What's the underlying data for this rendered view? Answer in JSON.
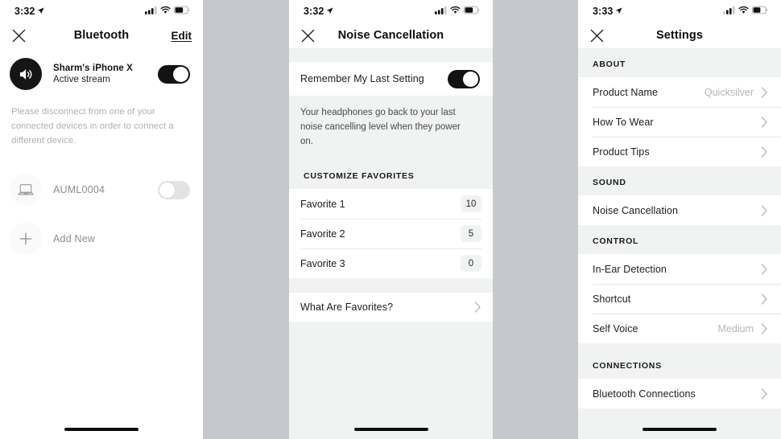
{
  "panels": {
    "bluetooth": {
      "status": {
        "time": "3:32",
        "location_icon": "location-arrow-icon",
        "cellular_icon": "cellular-bars-icon",
        "wifi_icon": "wifi-icon",
        "battery_icon": "battery-icon"
      },
      "nav": {
        "close_label": "✕",
        "title": "Bluetooth",
        "edit_label": "Edit"
      },
      "connected_device": {
        "icon": "speaker-icon",
        "name": "Sharm's iPhone X",
        "status": "Active stream",
        "toggle_state": "on"
      },
      "helper_text": "Please disconnect from one of your connected devices in order to connect a different device.",
      "other_device": {
        "icon": "laptop-icon",
        "name": "AUML0004",
        "toggle_state": "off"
      },
      "add_new": {
        "icon": "plus-icon",
        "label": "Add New"
      }
    },
    "noise_cancellation": {
      "status": {
        "time": "3:32",
        "location_icon": "location-arrow-icon",
        "cellular_icon": "cellular-bars-icon",
        "wifi_icon": "wifi-icon",
        "battery_icon": "battery-icon"
      },
      "nav": {
        "close_label": "✕",
        "title": "Noise Cancellation"
      },
      "remember": {
        "label": "Remember My Last Setting",
        "toggle_state": "on"
      },
      "description": "Your headphones go back to your last noise cancelling level when they power on.",
      "favorites_header": "CUSTOMIZE FAVORITES",
      "favorites": [
        {
          "label": "Favorite 1",
          "value": "10"
        },
        {
          "label": "Favorite 2",
          "value": "5"
        },
        {
          "label": "Favorite 3",
          "value": "0"
        }
      ],
      "what_are_favorites": {
        "label": "What Are Favorites?",
        "chevron": "chevron-right-icon"
      }
    },
    "settings": {
      "status": {
        "time": "3:33",
        "location_icon": "location-arrow-icon",
        "cellular_icon": "cellular-bars-icon",
        "wifi_icon": "wifi-icon",
        "battery_icon": "battery-icon"
      },
      "nav": {
        "close_label": "✕",
        "title": "Settings"
      },
      "sections": [
        {
          "header": "ABOUT",
          "rows": [
            {
              "label": "Product Name",
              "value": "Quicksilver",
              "chevron": "chevron-right-icon"
            },
            {
              "label": "How To Wear",
              "value": "",
              "chevron": "chevron-right-icon"
            },
            {
              "label": "Product Tips",
              "value": "",
              "chevron": "chevron-right-icon"
            }
          ]
        },
        {
          "header": "SOUND",
          "rows": [
            {
              "label": "Noise Cancellation",
              "value": "",
              "chevron": "chevron-right-icon"
            }
          ]
        },
        {
          "header": "CONTROL",
          "rows": [
            {
              "label": "In-Ear Detection",
              "value": "",
              "chevron": "chevron-right-icon"
            },
            {
              "label": "Shortcut",
              "value": "",
              "chevron": "chevron-right-icon"
            },
            {
              "label": "Self Voice",
              "value": "Medium",
              "chevron": "chevron-right-icon"
            }
          ]
        },
        {
          "header": "CONNECTIONS",
          "rows": [
            {
              "label": "Bluetooth Connections",
              "value": "",
              "chevron": "chevron-right-icon"
            }
          ]
        }
      ]
    }
  },
  "colors": {
    "background_gap": "#c5c9cd",
    "band": "#f1f2f2",
    "toggle_on": "#121212",
    "toggle_off": "#e2e3e4",
    "muted_text": "#b0b0b0"
  }
}
